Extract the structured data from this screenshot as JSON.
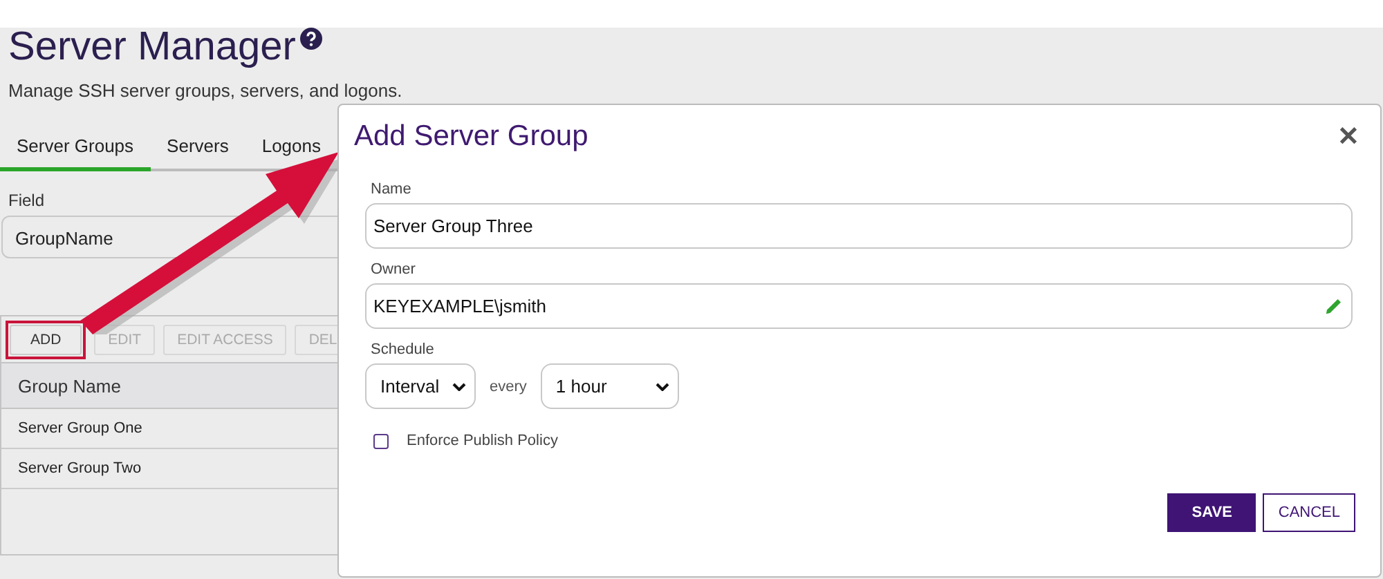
{
  "page": {
    "title": "Server Manager",
    "subtitle": "Manage SSH server groups, servers, and logons."
  },
  "tabs": [
    {
      "label": "Server Groups",
      "selected": true
    },
    {
      "label": "Servers",
      "selected": false
    },
    {
      "label": "Logons",
      "selected": false
    }
  ],
  "filter": {
    "label": "Field",
    "value": "GroupName"
  },
  "toolbar": [
    {
      "label": "ADD",
      "disabled": false,
      "highlighted": true
    },
    {
      "label": "EDIT",
      "disabled": true,
      "highlighted": false
    },
    {
      "label": "EDIT ACCESS",
      "disabled": true,
      "highlighted": false
    },
    {
      "label": "DEL",
      "disabled": true,
      "highlighted": false
    }
  ],
  "table": {
    "columns": [
      "Group Name"
    ],
    "rows": [
      [
        "Server Group One"
      ],
      [
        "Server Group Two"
      ]
    ]
  },
  "dialog": {
    "title": "Add Server Group",
    "close": "✕",
    "name": {
      "label": "Name",
      "value": "Server Group Three"
    },
    "owner": {
      "label": "Owner",
      "value": "KEYEXAMPLE\\jsmith"
    },
    "schedule": {
      "label": "Schedule",
      "type": "Interval",
      "connector": "every",
      "interval": "1 hour"
    },
    "enforce_publish_policy": {
      "label": "Enforce Publish Policy",
      "checked": false
    },
    "buttons": [
      {
        "label": "SAVE",
        "kind": "primary"
      },
      {
        "label": "CANCEL",
        "kind": "secondary"
      }
    ]
  }
}
